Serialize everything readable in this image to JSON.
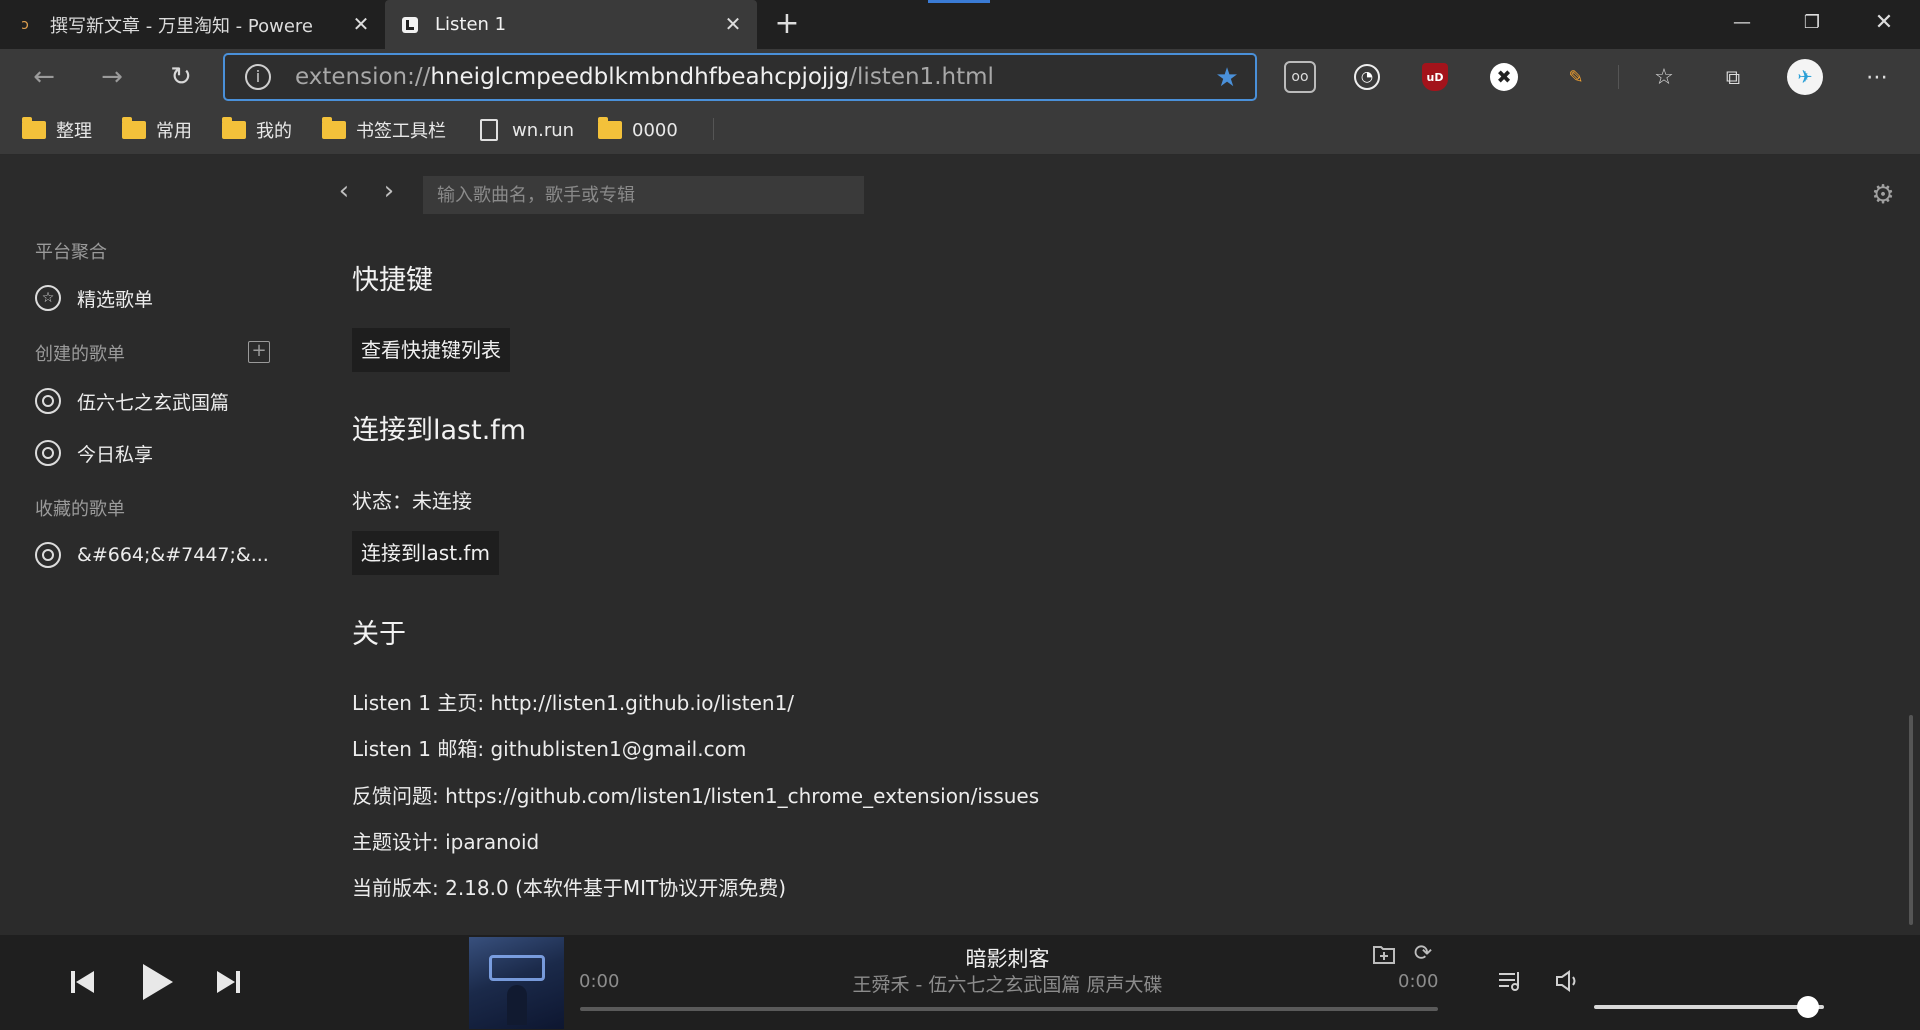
{
  "browser": {
    "tabs": [
      {
        "title": "撰写新文章 - 万里淘知 - Powere",
        "favicon": "zhihu-icon",
        "active": false
      },
      {
        "title": "Listen 1",
        "favicon": "listen1-icon",
        "active": true
      }
    ],
    "address": {
      "scheme": "extension://",
      "host": "hneiglcmpeedblkmbndhfbeahcpjojjg",
      "path": "/listen1.html"
    },
    "bookmarks": [
      {
        "label": "整理",
        "type": "folder"
      },
      {
        "label": "常用",
        "type": "folder"
      },
      {
        "label": "我的",
        "type": "folder"
      },
      {
        "label": "书签工具栏",
        "type": "folder"
      },
      {
        "label": "wn.run",
        "type": "page"
      },
      {
        "label": "0000",
        "type": "folder"
      }
    ],
    "accent": "#4a90d9"
  },
  "app": {
    "search_placeholder": "输入歌曲名，歌手或专辑",
    "sidebar": {
      "platform_header": "平台聚合",
      "featured": "精选歌单",
      "created_header": "创建的歌单",
      "created": [
        "伍六七之玄武国篇",
        "今日私享"
      ],
      "favorited_header": "收藏的歌单",
      "favorited": [
        "&#664;&#7447;&..."
      ]
    },
    "settings": {
      "shortcuts_title": "快捷键",
      "shortcuts_button": "查看快捷键列表",
      "lastfm_title": "连接到last.fm",
      "lastfm_status": "状态：未连接",
      "lastfm_button": "连接到last.fm",
      "about_title": "关于",
      "about_lines": [
        "Listen 1 主页: http://listen1.github.io/listen1/",
        "Listen 1 邮箱: githublisten1@gmail.com",
        "反馈问题: https://github.com/listen1/listen1_chrome_extension/issues",
        "主题设计: iparanoid",
        "当前版本: 2.18.0 (本软件基于MIT协议开源免费)"
      ]
    }
  },
  "player": {
    "title": "暗影刺客",
    "artist_album": "王舜禾 - 伍六七之玄武国篇 原声大碟",
    "current_time": "0:00",
    "total_time": "0:00",
    "progress": 0.0,
    "volume": 0.93
  }
}
